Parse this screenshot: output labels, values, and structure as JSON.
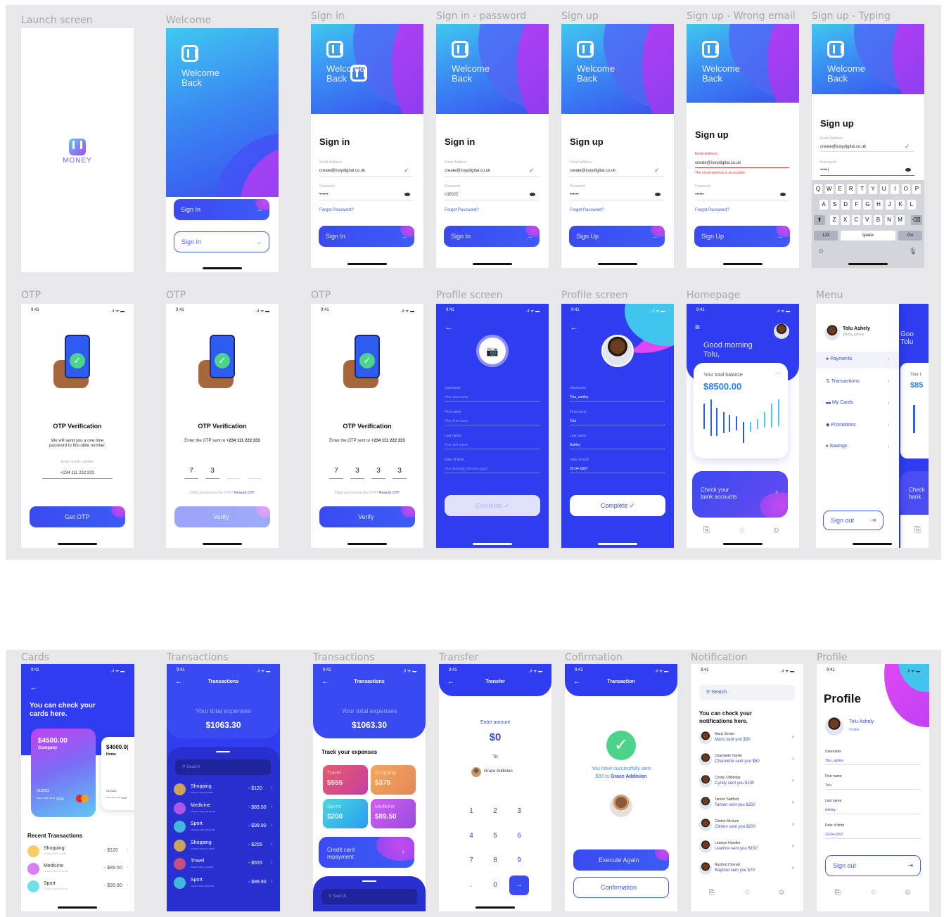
{
  "frames": {
    "launch": "Launch screen",
    "welcome": "Welcome",
    "signin": "Sign in",
    "signin_pw": "Sign in - password",
    "signup": "Sign up",
    "signup_wrong": "Sign up - Wrong email",
    "signup_typing": "Sign up - Typing",
    "otp1": "OTP",
    "otp2": "OTP",
    "otp3": "OTP",
    "profile1": "Profile screen",
    "profile2": "Profile screen",
    "home": "Homepage",
    "menu": "Menu",
    "cards": "Cards",
    "tx1": "Transactions",
    "tx2": "Transactions",
    "transfer": "Transfer",
    "confirm": "Cofirmation",
    "notif": "Notification",
    "profile": "Profile"
  },
  "launch": {
    "brand": "MONEY"
  },
  "welcome": {
    "heading_l1": "Welcome",
    "heading_l2": "Back",
    "btn1": "Sign In",
    "btn2": "Sign In",
    "arrow": "→"
  },
  "common": {
    "welcome_l1": "Welcome",
    "welcome_l2": "Back",
    "time": "9:41",
    "signal": "..ıl ᯤ ▬",
    "check": "✓",
    "arrow": "→",
    "back": "←",
    "chev": "›"
  },
  "signin": {
    "title": "Sign in",
    "email_label": "Email Address",
    "email": "create@iceydigital.co.uk",
    "pw_label": "Password",
    "pw": "••••••",
    "forgot": "Forgot Password?",
    "btn": "Sign In"
  },
  "signin_pw": {
    "title": "Sign in",
    "email_label": "Email Address",
    "email": "create@iceydigital.co.uk",
    "pw_label": "Password",
    "pw": "UI2022",
    "forgot": "Forgot Password?",
    "btn": "Sign In"
  },
  "signup": {
    "title": "Sign up",
    "email_label": "Email Address",
    "email": "create@iceydigital.co.uk",
    "pw_label": "Password",
    "pw": "••••••",
    "forgot": "Forgot Password?",
    "btn": "Sign Up"
  },
  "signup_wrong": {
    "title": "Sign up",
    "email_label": "Email Address",
    "email": "create@iceydigital.co.uk",
    "error": "The email address is accessible.",
    "pw_label": "Password",
    "pw": "••••••",
    "forgot": "Forgot Password?",
    "btn": "Sign Up"
  },
  "signup_typing": {
    "title": "Sign up",
    "email_label": "Email Address",
    "email": "create@iceydigital.co.uk",
    "pw_label": "Password",
    "pw": "•••••|",
    "row1": [
      "Q",
      "W",
      "E",
      "R",
      "T",
      "Y",
      "U",
      "I",
      "O",
      "P"
    ],
    "row2": [
      "A",
      "S",
      "D",
      "F",
      "G",
      "H",
      "J",
      "K",
      "L"
    ],
    "row3": [
      "Z",
      "X",
      "C",
      "V",
      "B",
      "N",
      "M"
    ],
    "shift": "⬆",
    "del": "⌫",
    "k123": "123",
    "space": "space",
    "go": "Go",
    "emoji": "☺",
    "mic": "🎙"
  },
  "otp1": {
    "title": "OTP Verification",
    "sub": "We will send you a one time password to this obile number.",
    "field_label": "Enter mobile number",
    "phone": "+234 111 222 333",
    "btn": "Get OTP"
  },
  "otp2": {
    "title": "OTP Verification",
    "sub": "Enter the OTP sent to",
    "sub_bold": "+234 111 222 333",
    "digits": [
      "7",
      "3",
      "",
      ""
    ],
    "resend_q": "Didnt you receive the OTP?",
    "resend": "Resend OTP",
    "btn": "Verify"
  },
  "otp3": {
    "title": "OTP Verification",
    "sub": "Enter the OTP sent to",
    "sub_bold": "+234 111 222 333",
    "digits": [
      "7",
      "3",
      "3",
      "3"
    ],
    "resend_q": "Didnt you receive the OTP?",
    "resend": "Resend OTP",
    "btn": "Verify"
  },
  "profile1": {
    "fields": [
      {
        "label": "Username",
        "value": "Your username"
      },
      {
        "label": "First name",
        "value": "Your first name"
      },
      {
        "label": "Last name",
        "value": "Your last name"
      },
      {
        "label": "Date of birth",
        "value": "Your birthday (dd-mm-yyyy)"
      }
    ],
    "btn": "Complete ✓",
    "camera": "📷"
  },
  "profile2": {
    "fields": [
      {
        "label": "Username",
        "value": "Tolu_ashley"
      },
      {
        "label": "First name",
        "value": "Tolu"
      },
      {
        "label": "Last name",
        "value": "Ashley"
      },
      {
        "label": "Date of birth",
        "value": "22-04-1997"
      }
    ],
    "btn": "Complete ✓"
  },
  "home": {
    "greet_l1": "Good morning",
    "greet_l2": "Tolu,",
    "balance_label": "Your total balance",
    "balance": "$8500.00",
    "more": "···",
    "check_l1": "Check your",
    "check_l2": "bank accounts",
    "menu": "≡"
  },
  "menu": {
    "name": "Tolu Ashely",
    "handle": "@tolu_ashely",
    "items": [
      "Payments",
      "Transactions",
      "My Cards",
      "Promotions",
      "Savings"
    ],
    "signout": "Sign out",
    "partial_greet": "Goo",
    "partial_name": "Tolu",
    "partial_bal": "Your t",
    "partial_amt": "$85",
    "partial_check": "Check",
    "partial_bank": "bank"
  },
  "cards": {
    "heading_l1": "You can check your",
    "heading_l2": "cards here.",
    "card1_amt": "$4500.00",
    "card1_type": "Company",
    "card1_exp": "01/2023",
    "card1_num": "**** **** **** 2234",
    "card2_amt": "$4000.0(",
    "card2_type": "Home",
    "card2_exp": "01/2023",
    "card2_num": "**** **** **** 343",
    "recent": "Recent Transactions",
    "tx": [
      {
        "name": "Shopping",
        "date": "15 March 2022, 8:20PM",
        "amt": "- $120"
      },
      {
        "name": "Medicine",
        "date": "13 March 2022, 12:20 AM",
        "amt": "- $89.50"
      },
      {
        "name": "Sport",
        "date": "11 March 2022, 06:00 PM",
        "amt": "- $99.90"
      }
    ]
  },
  "tx1": {
    "title": "Transactions",
    "total_label": "Your total expenses",
    "total": "$1063.30",
    "search": "Search",
    "list": [
      {
        "name": "Shopping",
        "date": "15 March 2022, 8:20PM",
        "amt": "- $120"
      },
      {
        "name": "Medicine",
        "date": "13 March 2022, 12:20 AM",
        "amt": "- $89.50"
      },
      {
        "name": "Sport",
        "date": "11 March 2022, 06:00 PM",
        "amt": "- $99.90"
      },
      {
        "name": "Shopping",
        "date": "10 March 2022, 07:20PM",
        "amt": "- $255"
      },
      {
        "name": "Travel",
        "date": "5 March 2022, 01:20PM",
        "amt": "- $555"
      },
      {
        "name": "Sport",
        "date": "3 March 2022, 06:50 PM",
        "amt": "- $99.90"
      }
    ]
  },
  "tx2": {
    "title": "Transactions",
    "total_label": "Your total expenses",
    "total": "$1063.30",
    "track": "Track your expenses",
    "tiles": [
      {
        "label": "Travel",
        "amt": "$555"
      },
      {
        "label": "Shopping",
        "amt": "$375"
      },
      {
        "label": "Sports",
        "amt": "$200"
      },
      {
        "label": "Medicine",
        "amt": "$89.50"
      }
    ],
    "credit_l1": "Credit card",
    "credit_l2": "repayment",
    "search": "Search"
  },
  "transfer": {
    "title": "Transfer",
    "enter": "Enter amount",
    "amount": "$0",
    "to": "To",
    "recipient": "Grace Addision",
    "keys": [
      "1",
      "2",
      "3",
      "4",
      "5",
      "6",
      "7",
      "8",
      "9",
      ".",
      "0",
      "→"
    ]
  },
  "confirm": {
    "title": "Transaction",
    "msg_l1": "You have successfully sent",
    "msg_pre": "$99 to",
    "msg_name": "Grace Addision",
    "btn1": "Execute Again",
    "btn2": "Confirmation"
  },
  "notif": {
    "search": "Search",
    "heading_l1": "You can check your",
    "heading_l2": "notifications here.",
    "items": [
      {
        "name": "Marci Senter",
        "msg": "Marci sent you $30"
      },
      {
        "name": "Charolette Hanlin",
        "msg": "Charolette sent you $50"
      },
      {
        "name": "Cyndy Lillibridge",
        "msg": "Cyndy sent you $100"
      },
      {
        "name": "Tanner Stafford",
        "msg": "Tanner sent you $250"
      },
      {
        "name": "Clinton Mcclure",
        "msg": "Clinton sent you $200"
      },
      {
        "name": "Leatrice Handler",
        "msg": "Leatrice sent you $150"
      },
      {
        "name": "Rayford Chenail",
        "msg": "Rayford sent you $70"
      }
    ]
  },
  "profile": {
    "title": "Profile",
    "name": "Tolu Ashely",
    "status": "Online",
    "fields": [
      {
        "label": "Username",
        "value": "Tolu_ashley"
      },
      {
        "label": "First name",
        "value": "Tolu"
      },
      {
        "label": "Last name",
        "value": "Ashley"
      },
      {
        "label": "Date of birth",
        "value": "22-04-1997"
      }
    ],
    "signout": "Sign out"
  },
  "colors": {
    "primary": "#2f3cf0",
    "accent": "#b640f2",
    "cyan": "#40c8f0",
    "green": "#4cd48a"
  }
}
